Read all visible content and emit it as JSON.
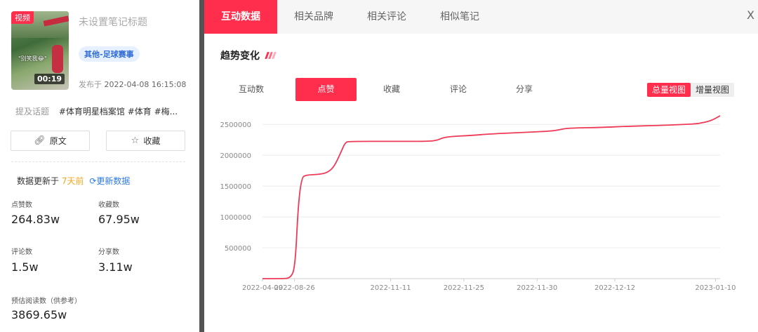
{
  "note": {
    "video_badge": "视频",
    "thumb_caption": "\"别笑我😂\"",
    "duration": "00:19",
    "title": "未设置笔记标题",
    "category": "其他-足球赛事",
    "publish_label": "发布于",
    "publish_time": "2022-04-08 16:15:08",
    "topics_label": "提及话题",
    "topics": "#体育明星档案馆 #体育 #梅..."
  },
  "actions": {
    "source_label": "原文",
    "favorite_label": "收藏"
  },
  "update": {
    "prefix": "数据更新于",
    "ago": "7天前",
    "refresh_label": "更新数据"
  },
  "stats": [
    {
      "label": "点赞数",
      "value": "264.83w"
    },
    {
      "label": "收藏数",
      "value": "67.95w"
    },
    {
      "label": "评论数",
      "value": "1.5w"
    },
    {
      "label": "分享数",
      "value": "3.11w"
    },
    {
      "label": "预估阅读数（供参考）",
      "value": "3869.65w"
    }
  ],
  "tabs": [
    {
      "label": "互动数据",
      "active": true
    },
    {
      "label": "相关品牌",
      "active": false
    },
    {
      "label": "相关评论",
      "active": false
    },
    {
      "label": "相似笔记",
      "active": false
    }
  ],
  "close_label": "X",
  "trend": {
    "title": "趋势变化",
    "metric_tabs": [
      {
        "label": "互动数",
        "active": false
      },
      {
        "label": "点赞",
        "active": true
      },
      {
        "label": "收藏",
        "active": false
      },
      {
        "label": "评论",
        "active": false
      },
      {
        "label": "分享",
        "active": false
      }
    ],
    "views": [
      {
        "label": "总量视图",
        "active": true
      },
      {
        "label": "增量视图",
        "active": false
      }
    ]
  },
  "colors": {
    "accent": "#ff2e4d",
    "line": "#ee3a57",
    "link": "#2d7be5",
    "warn": "#f5a623"
  },
  "chart_data": {
    "type": "line",
    "xlabel": "",
    "ylabel": "",
    "ylim": [
      0,
      2650000
    ],
    "yticks": [
      500000,
      1000000,
      1500000,
      2000000,
      2500000
    ],
    "ytick_labels": [
      "500000",
      "1000000",
      "1500000",
      "2000000",
      "2500000"
    ],
    "xtick_labels": [
      "2022-04-09",
      "2022-08-26",
      "2022-11-11",
      "2022-11-25",
      "2022-11-30",
      "2022-12-12",
      "2023-01-10"
    ],
    "series": [
      {
        "values": [
          [
            0,
            0
          ],
          [
            0.04,
            0
          ],
          [
            0.065,
            5000
          ],
          [
            0.075,
            200000
          ],
          [
            0.082,
            1200000
          ],
          [
            0.09,
            1640000
          ],
          [
            0.1,
            1680000
          ],
          [
            0.13,
            1690000
          ],
          [
            0.15,
            1720000
          ],
          [
            0.165,
            1820000
          ],
          [
            0.18,
            2050000
          ],
          [
            0.19,
            2210000
          ],
          [
            0.2,
            2225000
          ],
          [
            0.3,
            2225000
          ],
          [
            0.38,
            2225000
          ],
          [
            0.4,
            2240000
          ],
          [
            0.42,
            2300000
          ],
          [
            0.48,
            2320000
          ],
          [
            0.52,
            2345000
          ],
          [
            0.6,
            2370000
          ],
          [
            0.66,
            2390000
          ],
          [
            0.68,
            2410000
          ],
          [
            0.7,
            2440000
          ],
          [
            0.78,
            2450000
          ],
          [
            0.84,
            2470000
          ],
          [
            0.92,
            2485000
          ],
          [
            0.97,
            2500000
          ],
          [
            1.0,
            2510000
          ],
          [
            1.03,
            2560000
          ],
          [
            1.05,
            2640000
          ]
        ]
      }
    ]
  }
}
